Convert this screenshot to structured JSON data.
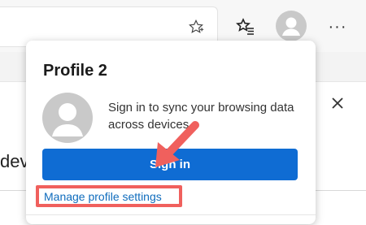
{
  "toolbar": {
    "favorite_icon": "star-outline-icon",
    "favorites_icon": "favorites-star-list-icon",
    "profile_icon": "person-icon",
    "more_label": "···"
  },
  "background_page": {
    "partial_text": "dev",
    "close_icon": "close-icon"
  },
  "profile_flyout": {
    "title": "Profile 2",
    "sync_message": "Sign in to sync your browsing data across devices.",
    "sign_in_label": "Sign in",
    "manage_link": "Manage profile settings"
  },
  "annotation": {
    "highlight_color": "#f0605d",
    "arrow_color": "#f0605d"
  },
  "colors": {
    "accent": "#0f6cd3",
    "link": "#0f6cbd"
  }
}
